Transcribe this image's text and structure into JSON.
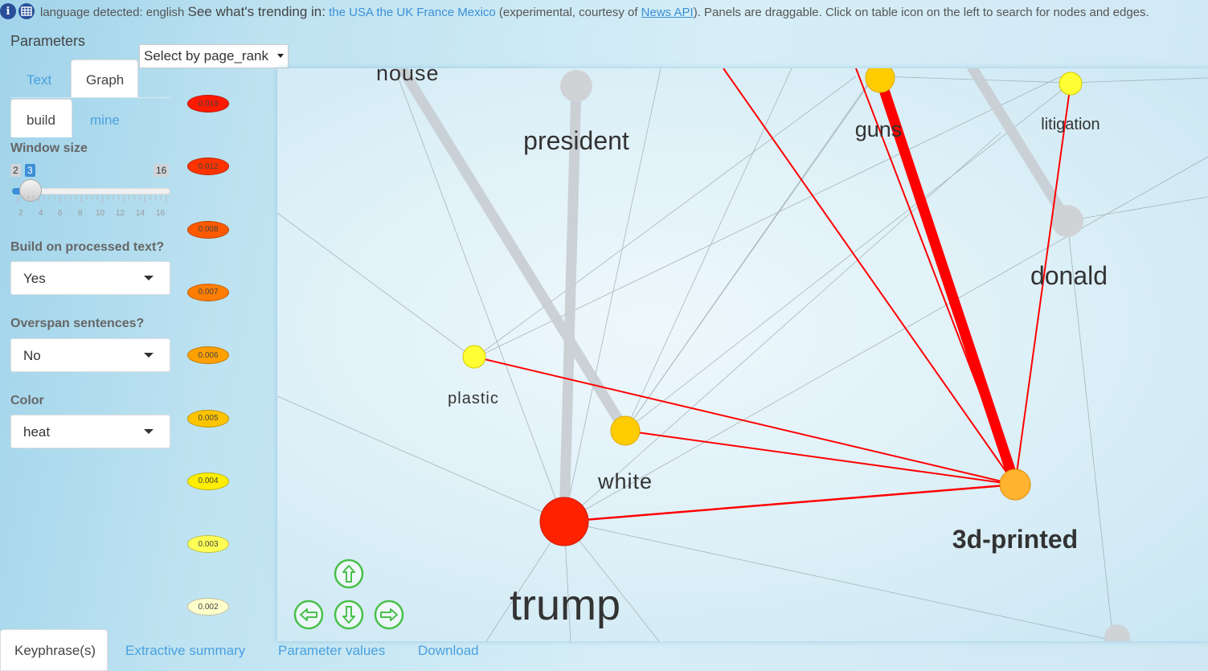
{
  "topbar": {
    "info_icon": "info-icon",
    "table_icon": "table-icon",
    "language": "language detected: english",
    "trending_prefix": "See what's trending in:",
    "countries": [
      "the USA",
      "the UK",
      "France",
      "Mexico"
    ],
    "experimental": "(experimental, courtesy of",
    "newsapi": "News API",
    "suffix": "). Panels are draggable. Click on table icon on the left to search for nodes and edges."
  },
  "params": {
    "title": "Parameters",
    "select_by": "Select by page_rank",
    "tabs": [
      "Text",
      "Graph"
    ],
    "active_tab": "Graph",
    "subtabs": [
      "build",
      "mine"
    ],
    "active_subtab": "build",
    "window_size_label": "Window size",
    "slider": {
      "min": "2",
      "value": "3",
      "max": "16",
      "ticks": [
        "2",
        "4",
        "6",
        "8",
        "10",
        "12",
        "14",
        "16"
      ]
    },
    "processed_label": "Build on processed text?",
    "processed_value": "Yes",
    "overspan_label": "Overspan sentences?",
    "overspan_value": "No",
    "color_label": "Color",
    "color_value": "heat"
  },
  "legend": [
    {
      "label": "0.019",
      "color": "#ff1a00"
    },
    {
      "label": "0.012",
      "color": "#ff3300"
    },
    {
      "label": "0.008",
      "color": "#ff5a00"
    },
    {
      "label": "0.007",
      "color": "#ff7d00"
    },
    {
      "label": "0.006",
      "color": "#ffa000"
    },
    {
      "label": "0.005",
      "color": "#ffc400"
    },
    {
      "label": "0.004",
      "color": "#ffee00"
    },
    {
      "label": "0.003",
      "color": "#ffff55"
    },
    {
      "label": "0.002",
      "color": "#ffffcc"
    }
  ],
  "graph": {
    "nodes": {
      "nouse": "nouse",
      "president": "president",
      "guns": "guns",
      "litigation": "litigation",
      "donald": "donald",
      "plastic": "plastic",
      "white": "white",
      "trump": "trump",
      "printed": "3d-printed"
    },
    "nav_icons": [
      "arrow-up-icon",
      "arrow-left-icon",
      "arrow-down-icon",
      "arrow-right-icon"
    ]
  },
  "bottom_tabs": [
    "Keyphrase(s)",
    "Extractive summary",
    "Parameter values",
    "Download"
  ],
  "active_bottom_tab": "Keyphrase(s)"
}
